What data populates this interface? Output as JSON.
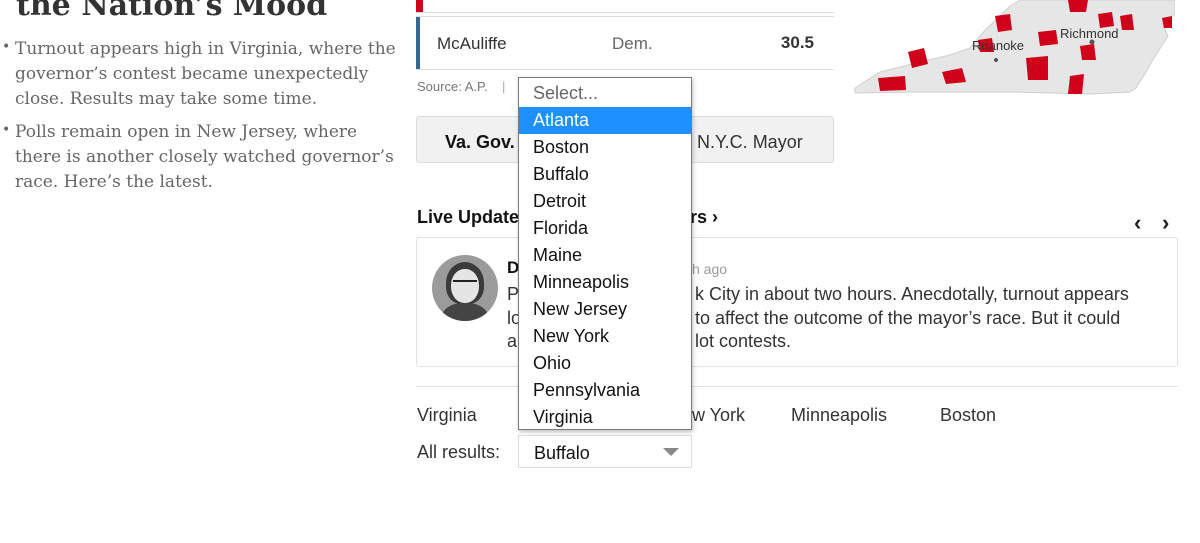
{
  "left": {
    "headline": "the Nation’s Mood",
    "bullets": [
      {
        "lines": [
          "Turnout appears high in Virginia, where the",
          "governor’s contest became unexpectedly",
          "close. Results may take some time."
        ]
      },
      {
        "lines": [
          "Polls remain open in New Jersey, where",
          "there is another closely watched governor’s",
          "race. Here’s the latest."
        ]
      }
    ]
  },
  "results": {
    "row": {
      "name": "McAuliffe",
      "party": "Dem.",
      "pct": "30.5",
      "bar_color": "#326891"
    },
    "source": "Source: A.P.",
    "separator": "|",
    "top_bar_color": "#d0021b"
  },
  "tabs": {
    "va_gov": "Va. Gov.",
    "nyc_mayor": "N.Y.C. Mayor"
  },
  "map": {
    "labels": {
      "roanoke": "Roanoke",
      "richmond": "Richmond"
    },
    "land_color": "#e6e6e6",
    "county_color": "#d0021b"
  },
  "live": {
    "title": "Live Update",
    "title_tail": "rs ›",
    "prev_icon": "chevron-left-icon",
    "next_icon": "chevron-right-icon",
    "card": {
      "author": "D",
      "time": "h ago",
      "lines": [
        {
          "left": "P",
          "right": "k City in about two hours. Anecdotally, turnout appears"
        },
        {
          "left": "lo",
          "right": "to affect the outcome of the mayor’s race. But it could"
        },
        {
          "left": "a",
          "right": "lot contests."
        }
      ]
    }
  },
  "quick_links": {
    "virginia": "Virginia",
    "new_york": "w York",
    "minneapolis": "Minneapolis",
    "boston": "Boston"
  },
  "all_results": {
    "label": "All results:",
    "selected": "Buffalo"
  },
  "dropdown": {
    "placeholder": "Select...",
    "options": [
      "Atlanta",
      "Boston",
      "Buffalo",
      "Detroit",
      "Florida",
      "Maine",
      "Minneapolis",
      "New Jersey",
      "New York",
      "Ohio",
      "Pennsylvania",
      "Virginia"
    ],
    "highlighted": "Atlanta",
    "highlight_color": "#1e90ff"
  }
}
